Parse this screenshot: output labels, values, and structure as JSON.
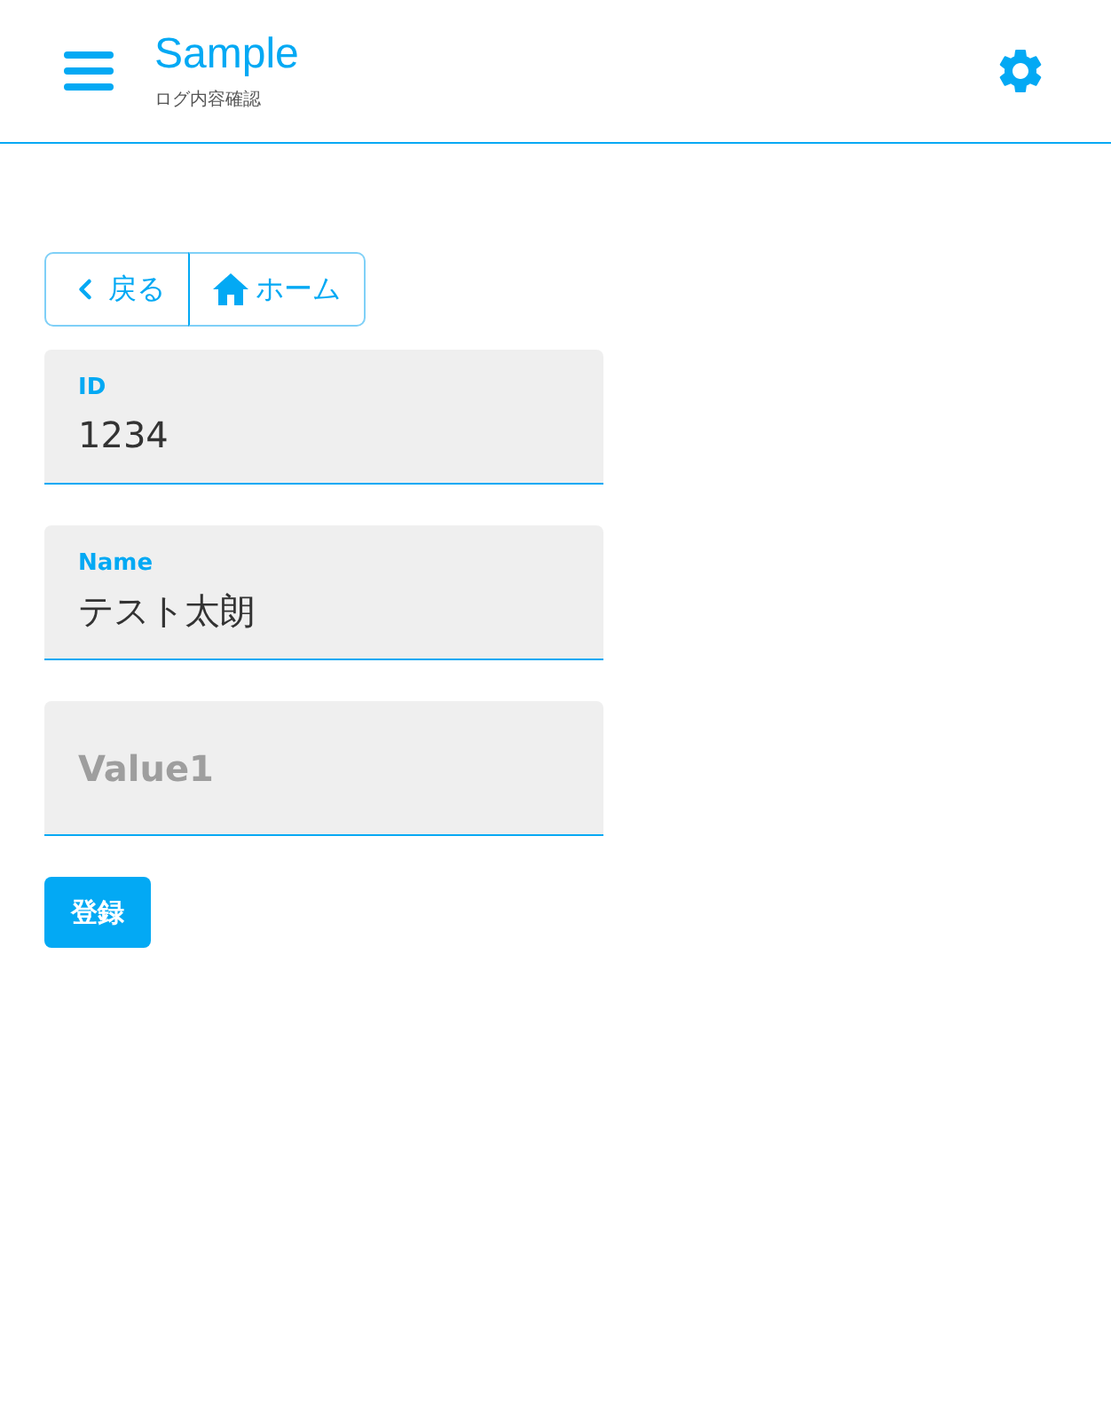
{
  "header": {
    "title": "Sample",
    "subtitle": "ログ内容確認"
  },
  "nav_buttons": [
    {
      "kind": "back",
      "label": "戻る"
    },
    {
      "kind": "home",
      "label": "ホーム"
    }
  ],
  "fields": [
    {
      "label": "ID",
      "value": "1234"
    },
    {
      "label": "Name",
      "value": "テスト太朗"
    },
    {
      "label": "Value1"
    }
  ],
  "submit": {
    "label": "登録"
  }
}
